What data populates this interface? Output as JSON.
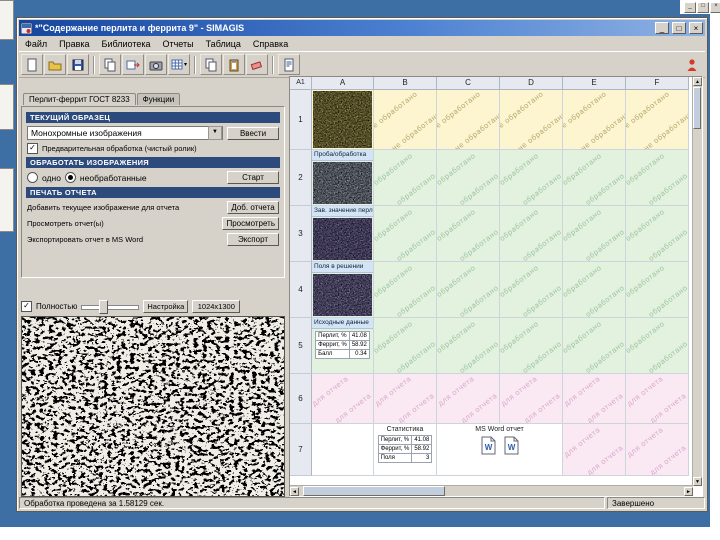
{
  "desktop": {
    "min": "_",
    "max": "□",
    "close": "×"
  },
  "window": {
    "title": "*\"Содержание перлита и феррита 9\" - SIMAGIS",
    "min": "_",
    "max": "□",
    "close": "×",
    "menu": [
      "Файл",
      "Правка",
      "Библиотека",
      "Отчеты",
      "Таблица",
      "Справка"
    ],
    "toolbar": [
      {
        "name": "new-page-icon",
        "glyph": "page"
      },
      {
        "name": "open-folder-icon",
        "glyph": "folder"
      },
      {
        "name": "save-icon",
        "glyph": "save"
      },
      {
        "name": "sep"
      },
      {
        "name": "copy-icon",
        "glyph": "copy"
      },
      {
        "name": "import-image-icon",
        "glyph": "import"
      },
      {
        "name": "camera-icon",
        "glyph": "camera"
      },
      {
        "name": "grid-settings-icon",
        "glyph": "grid",
        "dropdown": true
      },
      {
        "name": "sep"
      },
      {
        "name": "copy-page-icon",
        "glyph": "copy"
      },
      {
        "name": "paste-icon",
        "glyph": "paste"
      },
      {
        "name": "erase-icon",
        "glyph": "erase"
      },
      {
        "name": "sep"
      },
      {
        "name": "report-icon",
        "glyph": "report"
      }
    ]
  },
  "panel": {
    "tabs": [
      "Перлит-феррит ГОСТ 8233",
      "Функции"
    ],
    "section_current": "ТЕКУЩИЙ ОБРАЗЕЦ",
    "image_type_select": "Монохромные изображения",
    "enter_button": "Ввести",
    "preprocess_checkbox": "Предварительная обработка (чистый ролик)",
    "section_process": "ОБРАБОТАТЬ ИЗОБРАЖЕНИЯ",
    "radio_one": "одно",
    "radio_unprocessed": "необработанные",
    "start_button": "Старт",
    "section_report": "ПЕЧАТЬ ОТЧЕТА",
    "add_report_label": "Добавить текущее изображение для отчета",
    "add_report_button": "Доб. отчета",
    "view_report_label": "Просмотреть отчет(ы)",
    "view_report_button": "Просмотреть",
    "export_report_label": "Экспортировать отчет в MS Word",
    "export_report_button": "Экспорт",
    "zoom_checkbox": "Полностью",
    "zoom_settings_button": "Настройка",
    "zoom_size_button": "1024x1300"
  },
  "sheet": {
    "name_box": "A1",
    "columns": [
      "A",
      "B",
      "C",
      "D",
      "E",
      "F"
    ],
    "rows": [
      {
        "n": "1",
        "h": 60,
        "bg": "cream",
        "wm": "не обработано",
        "A": {
          "type": "thumb",
          "tint": "#a59a4e"
        }
      },
      {
        "n": "2",
        "h": 56,
        "bg": "green",
        "wm": "обработано",
        "A": {
          "type": "thumb",
          "tint": "#98a0b0",
          "label": "Проба/обработка"
        }
      },
      {
        "n": "3",
        "h": 56,
        "bg": "green",
        "wm": "обработано",
        "A": {
          "type": "thumb",
          "tint": "#7b70a8",
          "label": "Зав. значение перлита"
        }
      },
      {
        "n": "4",
        "h": 56,
        "bg": "green",
        "wm": "обработано",
        "A": {
          "type": "thumb",
          "tint": "#837aae",
          "label": "Поля в решении"
        }
      },
      {
        "n": "5",
        "h": 56,
        "bg": "green",
        "wm": "обработано",
        "A": {
          "type": "table",
          "label": "Исходные данные",
          "rows": [
            [
              "Перлит, %",
              "41.08"
            ],
            [
              "Феррит, %",
              "58.92"
            ],
            [
              "Балл",
              "0.34"
            ]
          ]
        }
      },
      {
        "n": "6",
        "h": 50,
        "bg": "pink",
        "wm": "для отчета",
        "A": {
          "type": "wm"
        }
      },
      {
        "n": "7",
        "h": 52,
        "bg": "white",
        "wm": "",
        "A": {
          "type": "blank"
        },
        "special": {
          "stats": {
            "title": "Статистика",
            "rows": [
              [
                "Перлит, %",
                "41.08"
              ],
              [
                "Феррит, %",
                "58.92"
              ],
              [
                "Поля",
                "3"
              ]
            ]
          },
          "word_title": "MS Word отчет",
          "tail_wm": "для отчета"
        }
      }
    ]
  },
  "status": {
    "left": "Обработка проведена за 1.58129 сек.",
    "right": "Завершено"
  }
}
